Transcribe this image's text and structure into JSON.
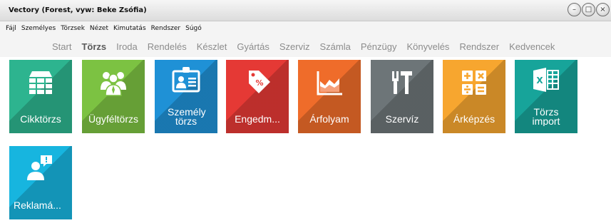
{
  "window": {
    "title": "Vectory (Forest, vyw: Beke Zsófia)",
    "buttons": [
      "minimize",
      "maximize",
      "close"
    ]
  },
  "menu": [
    "Fájl",
    "Személyes",
    "Törzsek",
    "Nézet",
    "Kimutatás",
    "Rendszer",
    "Súgó"
  ],
  "nav_tabs": [
    {
      "label": "Start",
      "active": false
    },
    {
      "label": "Törzs",
      "active": true
    },
    {
      "label": "Iroda",
      "active": false
    },
    {
      "label": "Rendelés",
      "active": false
    },
    {
      "label": "Készlet",
      "active": false
    },
    {
      "label": "Gyártás",
      "active": false
    },
    {
      "label": "Szerviz",
      "active": false
    },
    {
      "label": "Számla",
      "active": false
    },
    {
      "label": "Pénzügy",
      "active": false
    },
    {
      "label": "Könyvelés",
      "active": false
    },
    {
      "label": "Rendszer",
      "active": false
    },
    {
      "label": "Kedvencek",
      "active": false
    }
  ],
  "tiles": [
    {
      "label": "Cikktörzs",
      "color": "#2db48f",
      "icon": "grid-table-icon"
    },
    {
      "label": "Ügyféltörzs",
      "color": "#7cc242",
      "icon": "people-group-icon"
    },
    {
      "label": "Személy törzs",
      "color": "#1f91d6",
      "icon": "id-card-icon"
    },
    {
      "label": "Engedm...",
      "color": "#e53935",
      "icon": "price-tag-icon"
    },
    {
      "label": "Árfolyam",
      "color": "#ef6c2a",
      "icon": "area-chart-icon"
    },
    {
      "label": "Szervíz",
      "color": "#6d7578",
      "icon": "tools-icon"
    },
    {
      "label": "Árképzés",
      "color": "#f7a62f",
      "icon": "calculator-icon"
    },
    {
      "label": "Törzs import",
      "color": "#17a49a",
      "icon": "excel-icon"
    },
    {
      "label": "Reklamá...",
      "color": "#17b5df",
      "icon": "user-alert-icon"
    }
  ]
}
